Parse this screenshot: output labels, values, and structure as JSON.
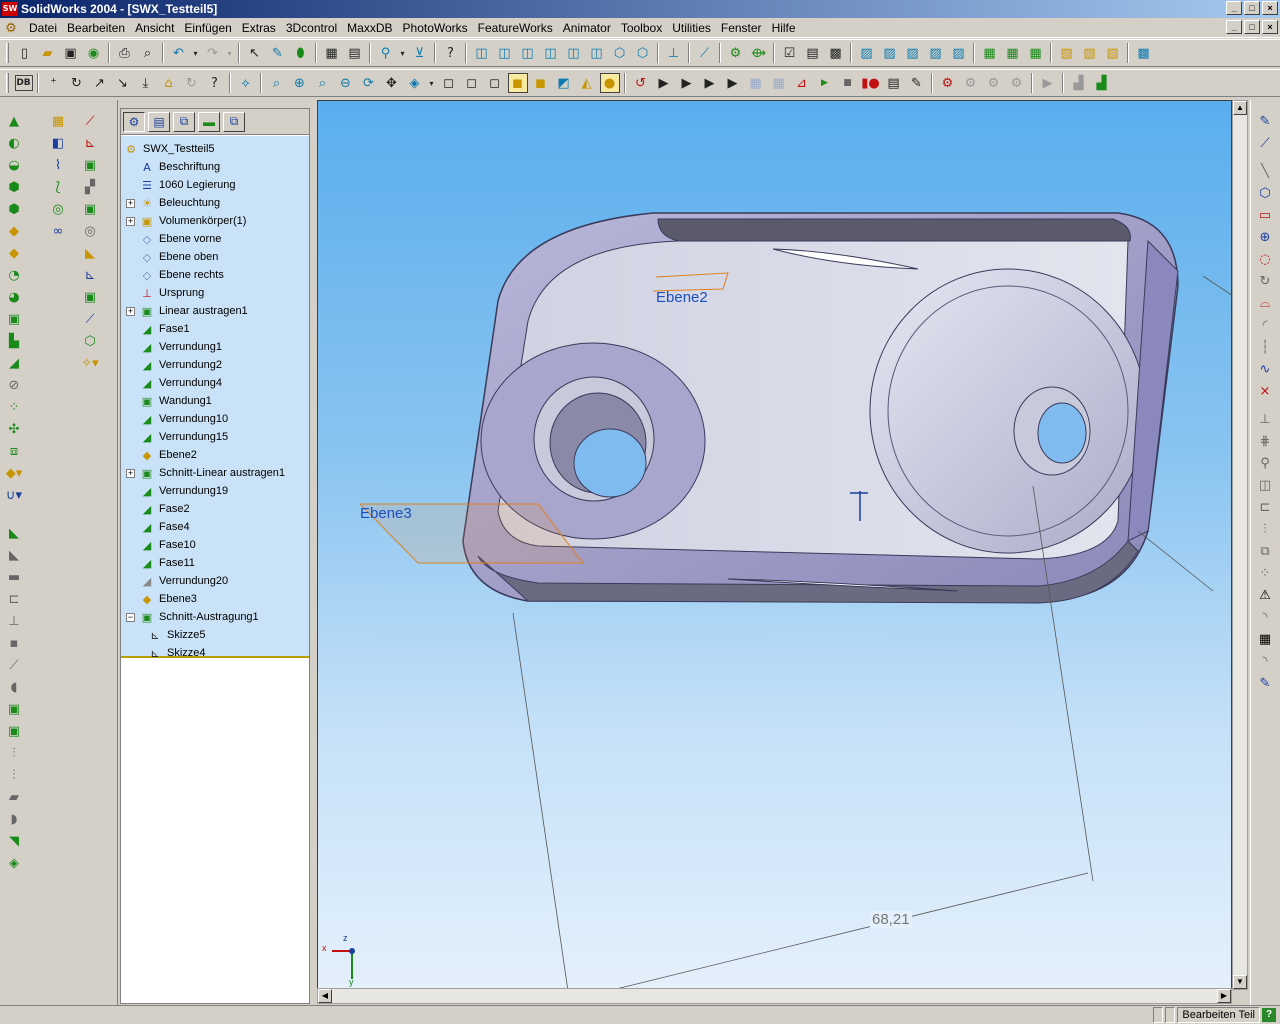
{
  "title": "SolidWorks 2004 - [SWX_Testteil5]",
  "app_logo": "SW",
  "window_buttons": [
    "_",
    "□",
    "×"
  ],
  "menu": [
    "Datei",
    "Bearbeiten",
    "Ansicht",
    "Einfügen",
    "Extras",
    "3Dcontrol",
    "MaxxDB",
    "PhotoWorks",
    "FeatureWorks",
    "Animator",
    "Toolbox",
    "Utilities",
    "Fenster",
    "Hilfe"
  ],
  "db_label": "DB",
  "tree": {
    "items": [
      {
        "label": "SWX_Testteil5",
        "icon": "part-icon",
        "level": 0,
        "exp": ""
      },
      {
        "label": "Beschriftung",
        "icon": "annotation-icon",
        "level": 1,
        "exp": ""
      },
      {
        "label": "1060 Legierung",
        "icon": "material-icon",
        "level": 1,
        "exp": ""
      },
      {
        "label": "Beleuchtung",
        "icon": "lighting-folder-icon",
        "level": 1,
        "exp": "+"
      },
      {
        "label": "Volumenkörper(1)",
        "icon": "solid-bodies-folder-icon",
        "level": 1,
        "exp": "+"
      },
      {
        "label": "Ebene vorne",
        "icon": "plane-icon",
        "level": 1,
        "exp": ""
      },
      {
        "label": "Ebene oben",
        "icon": "plane-icon",
        "level": 1,
        "exp": ""
      },
      {
        "label": "Ebene rechts",
        "icon": "plane-icon",
        "level": 1,
        "exp": ""
      },
      {
        "label": "Ursprung",
        "icon": "origin-icon",
        "level": 1,
        "exp": ""
      },
      {
        "label": "Linear austragen1",
        "icon": "extrude-icon",
        "level": 1,
        "exp": "+"
      },
      {
        "label": "Fase1",
        "icon": "chamfer-icon",
        "level": 1,
        "exp": ""
      },
      {
        "label": "Verrundung1",
        "icon": "fillet-icon",
        "level": 1,
        "exp": ""
      },
      {
        "label": "Verrundung2",
        "icon": "fillet-icon",
        "level": 1,
        "exp": ""
      },
      {
        "label": "Verrundung4",
        "icon": "fillet-icon",
        "level": 1,
        "exp": ""
      },
      {
        "label": "Wandung1",
        "icon": "shell-icon",
        "level": 1,
        "exp": ""
      },
      {
        "label": "Verrundung10",
        "icon": "fillet-icon",
        "level": 1,
        "exp": ""
      },
      {
        "label": "Verrundung15",
        "icon": "fillet-icon",
        "level": 1,
        "exp": ""
      },
      {
        "label": "Ebene2",
        "icon": "ref-plane-icon",
        "level": 1,
        "exp": ""
      },
      {
        "label": "Schnitt-Linear austragen1",
        "icon": "cut-extrude-icon",
        "level": 1,
        "exp": "+"
      },
      {
        "label": "Verrundung19",
        "icon": "fillet-icon",
        "level": 1,
        "exp": ""
      },
      {
        "label": "Fase2",
        "icon": "chamfer-icon",
        "level": 1,
        "exp": ""
      },
      {
        "label": "Fase4",
        "icon": "chamfer-icon",
        "level": 1,
        "exp": ""
      },
      {
        "label": "Fase10",
        "icon": "chamfer-icon",
        "level": 1,
        "exp": ""
      },
      {
        "label": "Fase11",
        "icon": "chamfer-icon",
        "level": 1,
        "exp": ""
      },
      {
        "label": "Verrundung20",
        "icon": "fillet-suppressed-icon",
        "level": 1,
        "exp": ""
      },
      {
        "label": "Ebene3",
        "icon": "ref-plane-icon",
        "level": 1,
        "exp": ""
      },
      {
        "label": "Schnitt-Austragung1",
        "icon": "cut-sweep-icon",
        "level": 1,
        "exp": "−"
      },
      {
        "label": "Skizze5",
        "icon": "sketch-icon",
        "level": 2,
        "exp": ""
      },
      {
        "label": "Skizze4",
        "icon": "sketch-icon",
        "level": 2,
        "exp": ""
      }
    ]
  },
  "viewport": {
    "plane_labels": [
      "Ebene2",
      "Ebene3"
    ],
    "dimension": "68,21",
    "triad": {
      "x": "x",
      "y": "y",
      "z": "z"
    }
  },
  "status": {
    "mode": "Bearbeiten Teil",
    "help": "?"
  }
}
